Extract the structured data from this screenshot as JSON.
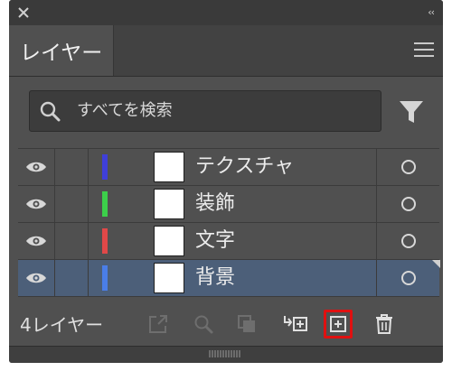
{
  "panel": {
    "tab_label": "レイヤー"
  },
  "search": {
    "placeholder": "すべてを検索"
  },
  "layers": [
    {
      "name": "テクスチャ",
      "color": "#3f3fd8",
      "selected": false
    },
    {
      "name": "装飾",
      "color": "#3ccf4a",
      "selected": false
    },
    {
      "name": "文字",
      "color": "#e04848",
      "selected": false
    },
    {
      "name": "背景",
      "color": "#4a7ee8",
      "selected": true
    }
  ],
  "footer": {
    "count_label": "4レイヤー"
  },
  "colors": {
    "panel_bg": "#505050",
    "selected_row": "#4c5f79",
    "highlight_border": "#e01010"
  }
}
